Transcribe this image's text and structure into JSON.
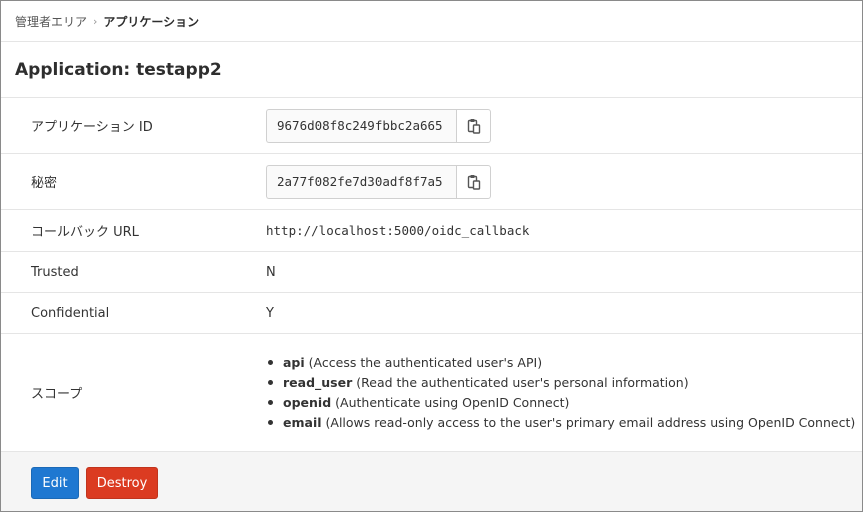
{
  "breadcrumb": {
    "parent": "管理者エリア",
    "separator": "›",
    "current": "アプリケーション"
  },
  "page": {
    "title": "Application: testapp2"
  },
  "details": {
    "app_id": {
      "label": "アプリケーション ID",
      "value": "9676d08f8c249fbbc2a665"
    },
    "secret": {
      "label": "秘密",
      "value": "2a77f082fe7d30adf8f7a5"
    },
    "callback": {
      "label": "コールバック URL",
      "value": "http://localhost:5000/oidc_callback"
    },
    "trusted": {
      "label": "Trusted",
      "value": "N"
    },
    "confidential": {
      "label": "Confidential",
      "value": "Y"
    },
    "scopes": {
      "label": "スコープ",
      "items": [
        {
          "name": "api",
          "desc": "(Access the authenticated user's API)"
        },
        {
          "name": "read_user",
          "desc": "(Read the authenticated user's personal information)"
        },
        {
          "name": "openid",
          "desc": "(Authenticate using OpenID Connect)"
        },
        {
          "name": "email",
          "desc": "(Allows read-only access to the user's primary email address using OpenID Connect)"
        }
      ]
    }
  },
  "actions": {
    "edit": "Edit",
    "destroy": "Destroy"
  },
  "colors": {
    "edit": "#1f78d1",
    "destroy": "#db3b21"
  },
  "icons": {
    "copy": "clipboard-icon"
  }
}
